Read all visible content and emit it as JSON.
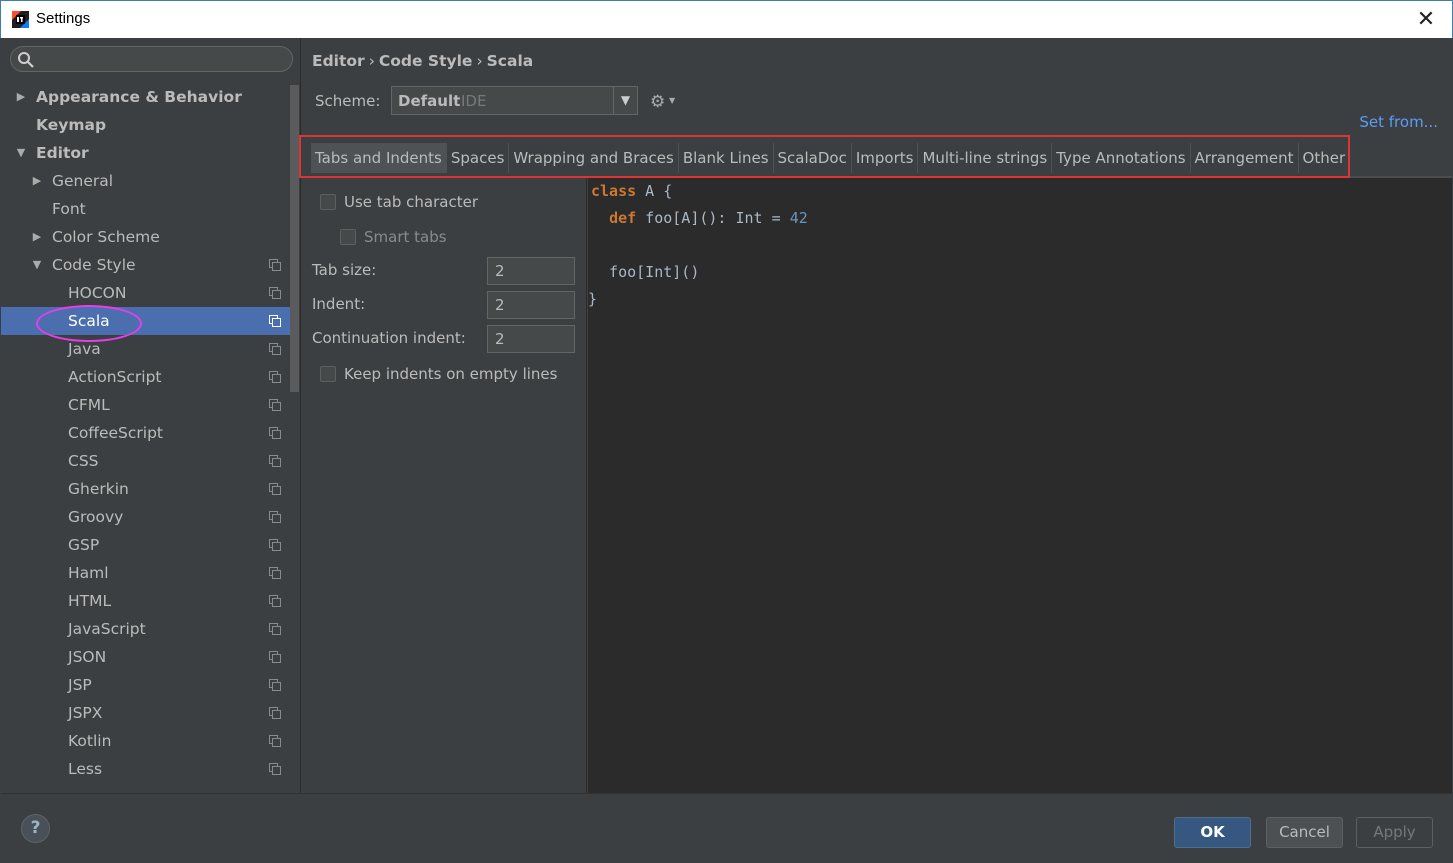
{
  "window": {
    "title": "Settings",
    "close_glyph": "✕"
  },
  "search": {
    "placeholder": ""
  },
  "tree": [
    {
      "label": "Appearance & Behavior",
      "indent": 0,
      "arrow": "▶",
      "bold": true,
      "copy": false
    },
    {
      "label": "Keymap",
      "indent": 0,
      "arrow": "",
      "bold": true,
      "copy": false
    },
    {
      "label": "Editor",
      "indent": 0,
      "arrow": "▼",
      "bold": true,
      "copy": false
    },
    {
      "label": "General",
      "indent": 1,
      "arrow": "▶",
      "bold": false,
      "copy": false
    },
    {
      "label": "Font",
      "indent": 1,
      "arrow": "",
      "bold": false,
      "copy": false
    },
    {
      "label": "Color Scheme",
      "indent": 1,
      "arrow": "▶",
      "bold": false,
      "copy": false
    },
    {
      "label": "Code Style",
      "indent": 1,
      "arrow": "▼",
      "bold": false,
      "copy": true
    },
    {
      "label": "HOCON",
      "indent": 2,
      "arrow": "",
      "bold": false,
      "copy": true
    },
    {
      "label": "Scala",
      "indent": 2,
      "arrow": "",
      "bold": false,
      "copy": true,
      "selected": true
    },
    {
      "label": "Java",
      "indent": 2,
      "arrow": "",
      "bold": false,
      "copy": true
    },
    {
      "label": "ActionScript",
      "indent": 2,
      "arrow": "",
      "bold": false,
      "copy": true
    },
    {
      "label": "CFML",
      "indent": 2,
      "arrow": "",
      "bold": false,
      "copy": true
    },
    {
      "label": "CoffeeScript",
      "indent": 2,
      "arrow": "",
      "bold": false,
      "copy": true
    },
    {
      "label": "CSS",
      "indent": 2,
      "arrow": "",
      "bold": false,
      "copy": true
    },
    {
      "label": "Gherkin",
      "indent": 2,
      "arrow": "",
      "bold": false,
      "copy": true
    },
    {
      "label": "Groovy",
      "indent": 2,
      "arrow": "",
      "bold": false,
      "copy": true
    },
    {
      "label": "GSP",
      "indent": 2,
      "arrow": "",
      "bold": false,
      "copy": true
    },
    {
      "label": "Haml",
      "indent": 2,
      "arrow": "",
      "bold": false,
      "copy": true
    },
    {
      "label": "HTML",
      "indent": 2,
      "arrow": "",
      "bold": false,
      "copy": true
    },
    {
      "label": "JavaScript",
      "indent": 2,
      "arrow": "",
      "bold": false,
      "copy": true
    },
    {
      "label": "JSON",
      "indent": 2,
      "arrow": "",
      "bold": false,
      "copy": true
    },
    {
      "label": "JSP",
      "indent": 2,
      "arrow": "",
      "bold": false,
      "copy": true
    },
    {
      "label": "JSPX",
      "indent": 2,
      "arrow": "",
      "bold": false,
      "copy": true
    },
    {
      "label": "Kotlin",
      "indent": 2,
      "arrow": "",
      "bold": false,
      "copy": true
    },
    {
      "label": "Less",
      "indent": 2,
      "arrow": "",
      "bold": false,
      "copy": true
    }
  ],
  "breadcrumb": {
    "part1": "Editor",
    "part2": "Code Style",
    "part3": "Scala",
    "sep": "›"
  },
  "scheme": {
    "label": "Scheme:",
    "value": "Default",
    "sub": "IDE",
    "dropdown_glyph": "▼",
    "gear_glyph": "⚙",
    "gear_drop": "▼"
  },
  "set_from": "Set from...",
  "tabs": [
    {
      "label": "Tabs and Indents",
      "active": true
    },
    {
      "label": "Spaces"
    },
    {
      "label": "Wrapping and Braces"
    },
    {
      "label": "Blank Lines"
    },
    {
      "label": "ScalaDoc"
    },
    {
      "label": "Imports"
    },
    {
      "label": "Multi-line strings"
    },
    {
      "label": "Type Annotations"
    },
    {
      "label": "Arrangement"
    },
    {
      "label": "Other"
    }
  ],
  "options": {
    "use_tab": "Use tab character",
    "smart_tabs": "Smart tabs",
    "tab_size_label": "Tab size:",
    "tab_size": "2",
    "indent_label": "Indent:",
    "indent": "2",
    "cont_indent_label": "Continuation indent:",
    "cont_indent": "2",
    "keep_indents": "Keep indents on empty lines"
  },
  "code": {
    "l1_kw": "class",
    "l1_rest": " A {",
    "l2_indent": "  ",
    "l2_kw": "def",
    "l2_rest": " foo[A](): Int = ",
    "l2_num": "42",
    "l3": "  foo[Int]()",
    "l4": "}"
  },
  "buttons": {
    "help": "?",
    "ok": "OK",
    "cancel": "Cancel",
    "apply": "Apply"
  },
  "colors": {
    "selection": "#4b6eaf",
    "accent_link": "#589df6",
    "highlight_box": "#e03434",
    "circle": "#e83de8"
  }
}
